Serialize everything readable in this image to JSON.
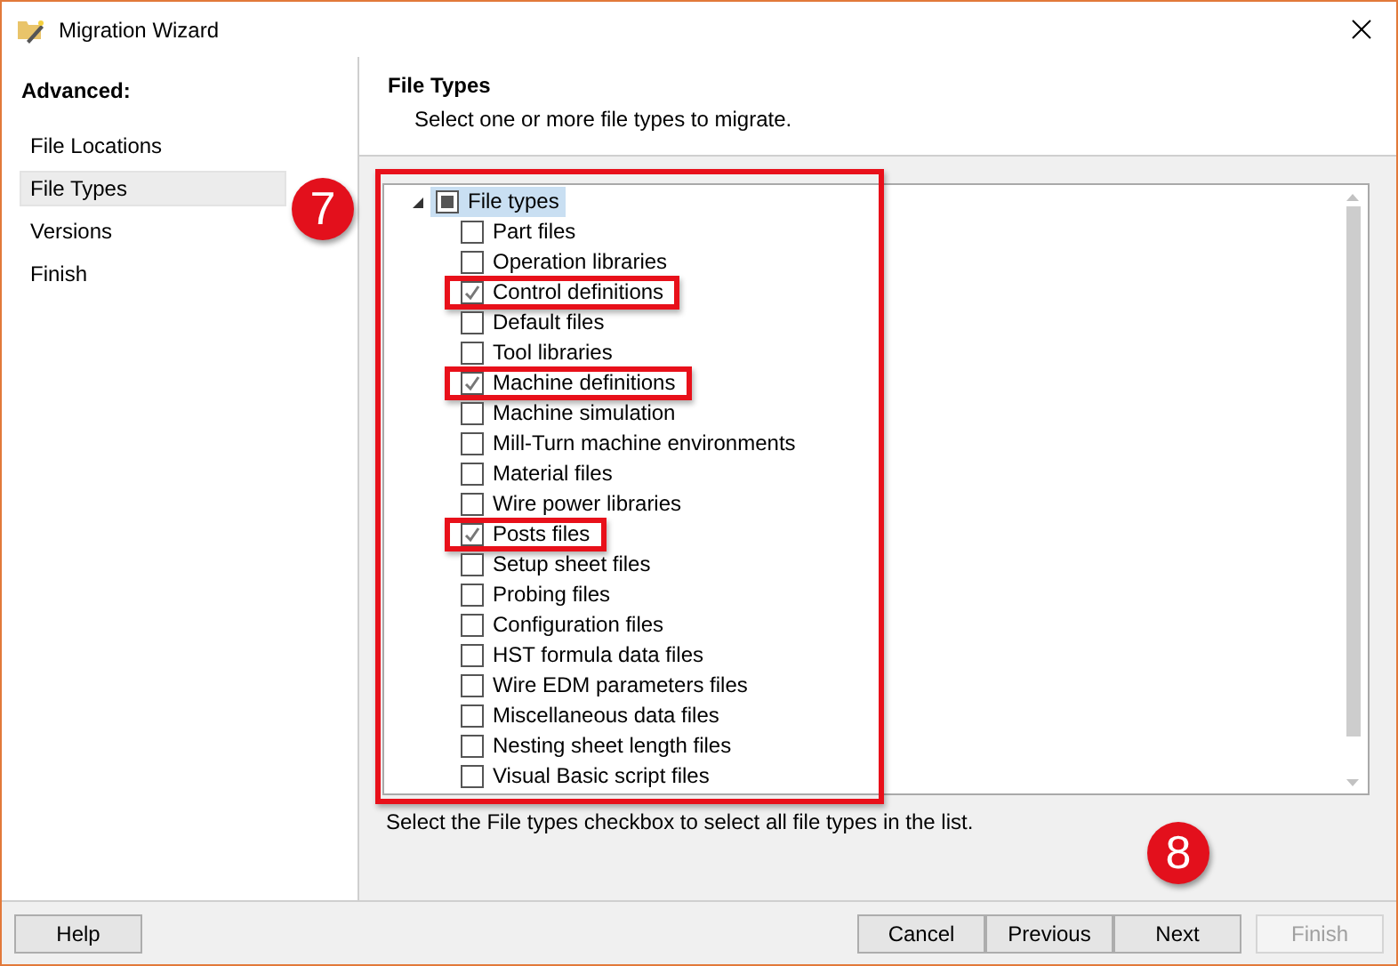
{
  "window": {
    "title": "Migration Wizard"
  },
  "sidebar": {
    "heading": "Advanced:",
    "items": [
      {
        "label": "File Locations",
        "selected": false
      },
      {
        "label": "File Types",
        "selected": true
      },
      {
        "label": "Versions",
        "selected": false
      },
      {
        "label": "Finish",
        "selected": false
      }
    ]
  },
  "page": {
    "title": "File Types",
    "subtitle": "Select one or more file types to migrate."
  },
  "tree": {
    "label": "File types",
    "expanded": true,
    "selected": true,
    "indeterminate": true,
    "children": [
      {
        "label": "Part files",
        "checked": false,
        "highlighted": false
      },
      {
        "label": "Operation libraries",
        "checked": false,
        "highlighted": false
      },
      {
        "label": "Control definitions",
        "checked": true,
        "highlighted": true
      },
      {
        "label": "Default files",
        "checked": false,
        "highlighted": false
      },
      {
        "label": "Tool libraries",
        "checked": false,
        "highlighted": false
      },
      {
        "label": "Machine definitions",
        "checked": true,
        "highlighted": true
      },
      {
        "label": "Machine simulation",
        "checked": false,
        "highlighted": false
      },
      {
        "label": "Mill-Turn machine environments",
        "checked": false,
        "highlighted": false
      },
      {
        "label": "Material files",
        "checked": false,
        "highlighted": false
      },
      {
        "label": "Wire power libraries",
        "checked": false,
        "highlighted": false
      },
      {
        "label": "Posts files",
        "checked": true,
        "highlighted": true
      },
      {
        "label": "Setup sheet files",
        "checked": false,
        "highlighted": false
      },
      {
        "label": "Probing files",
        "checked": false,
        "highlighted": false
      },
      {
        "label": "Configuration files",
        "checked": false,
        "highlighted": false
      },
      {
        "label": "HST formula data files",
        "checked": false,
        "highlighted": false
      },
      {
        "label": "Wire EDM parameters files",
        "checked": false,
        "highlighted": false
      },
      {
        "label": "Miscellaneous data files",
        "checked": false,
        "highlighted": false
      },
      {
        "label": "Nesting sheet length files",
        "checked": false,
        "highlighted": false
      },
      {
        "label": "Visual Basic script files",
        "checked": false,
        "highlighted": false
      }
    ]
  },
  "hint": "Select the File types checkbox to select all file types in the list.",
  "callouts": [
    {
      "label": "7"
    },
    {
      "label": "8"
    }
  ],
  "buttons": [
    {
      "label": "Help",
      "disabled": false
    },
    {
      "label": "Cancel",
      "disabled": false
    },
    {
      "label": "Previous",
      "disabled": false
    },
    {
      "label": "Next",
      "disabled": false
    },
    {
      "label": "Finish",
      "disabled": true
    }
  ]
}
